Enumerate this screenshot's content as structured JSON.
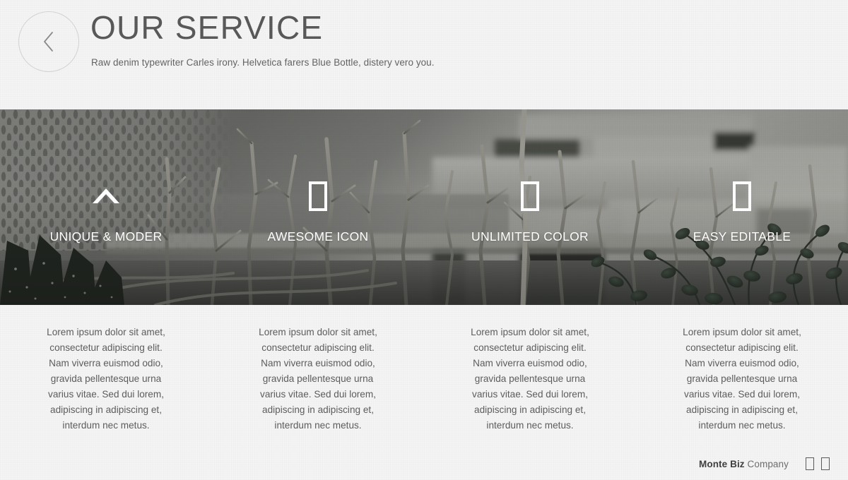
{
  "header": {
    "back_icon": "chevron-left-icon",
    "title": "OUR SERVICE",
    "subtitle": "Raw denim typewriter Carles irony. Helvetica farers Blue Bottle, distery vero you."
  },
  "banner": {
    "photo_description": "desaturated photo of bare branches and succulents in front of a perforated metal screen and pale concrete wall",
    "features": [
      {
        "icon": "chevron-up-icon",
        "label": "UNIQUE & MODER"
      },
      {
        "icon": "missing-glyph-box-icon",
        "label": "AWESOME ICON"
      },
      {
        "icon": "missing-glyph-box-icon",
        "label": "UNLIMITED COLOR"
      },
      {
        "icon": "missing-glyph-box-icon",
        "label": "EASY EDITABLE"
      }
    ]
  },
  "descriptions": [
    "Lorem ipsum dolor sit amet, consectetur adipiscing elit. Nam viverra euismod odio, gravida pellentesque urna varius vitae. Sed dui lorem, adipiscing in adipiscing et, interdum nec metus.",
    "Lorem ipsum dolor sit amet, consectetur adipiscing elit. Nam viverra euismod odio, gravida pellentesque urna varius vitae. Sed dui lorem, adipiscing in adipiscing et, interdum nec metus.",
    "Lorem ipsum dolor sit amet, consectetur adipiscing elit. Nam viverra euismod odio, gravida pellentesque urna varius vitae. Sed dui lorem, adipiscing in adipiscing et, interdum nec metus.",
    "Lorem ipsum dolor sit amet, consectetur adipiscing elit. Nam viverra euismod odio, gravida pellentesque urna varius vitae. Sed dui lorem, adipiscing in adipiscing et, interdum nec metus."
  ],
  "footer": {
    "brand_name": "Monte Biz",
    "brand_suffix": " Company",
    "icons": [
      "missing-glyph-box-icon",
      "missing-glyph-box-icon"
    ]
  },
  "colors": {
    "page_background": "#f4f4f4",
    "title_text": "#595959",
    "body_text": "#5d5d5d",
    "banner_overlay": "#2a2c2a",
    "feature_label": "#ffffff",
    "back_button_border": "#d3d3d3"
  }
}
